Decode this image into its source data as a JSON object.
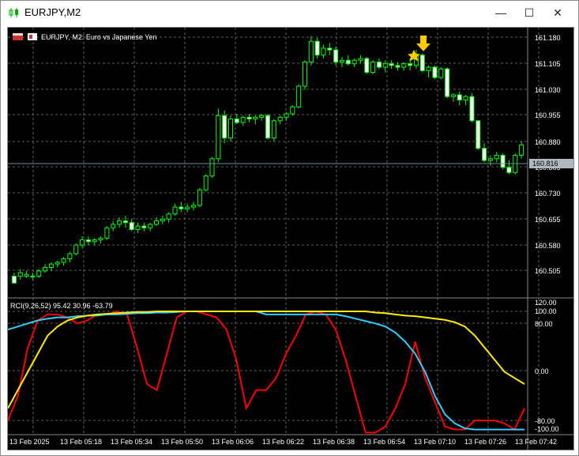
{
  "window": {
    "title": "EURJPY,M2",
    "controls": {
      "minimize": "—",
      "maximize": "☐",
      "close": "✕"
    }
  },
  "chart_header": {
    "label": "EURJPY, M2:  Euro vs Japanese Yen"
  },
  "price_axis": {
    "labels": [
      "161.180",
      "161.105",
      "161.030",
      "160.955",
      "160.880",
      "160.805",
      "160.730",
      "160.655",
      "160.580",
      "160.505"
    ],
    "current_price": "160.816"
  },
  "indicator_header": "RCI(9,26,52) 95.42 30.96 -63.79",
  "indicator_axis": {
    "labels": [
      "120.00",
      "100.00",
      "80.00",
      "0.00",
      "-80.00",
      "-100.00"
    ]
  },
  "time_axis": {
    "labels": [
      "13 Feb 2025",
      "13 Feb 05:18",
      "13 Feb 05:34",
      "13 Feb 05:50",
      "13 Feb 06:06",
      "13 Feb 06:22",
      "13 Feb 06:38",
      "13 Feb 06:54",
      "13 Feb 07:10",
      "13 Feb 07:26",
      "13 Feb 07:42"
    ]
  },
  "colors": {
    "background": "#000000",
    "candle": "#00ff00",
    "grid": "#606060",
    "rci_short": "#ff0000",
    "rci_mid": "#33ccff",
    "rci_long": "#ffee00",
    "marker": "#ffcc00"
  },
  "marker_icons": [
    "down-arrow-icon",
    "star-icon"
  ],
  "chart_data": [
    {
      "type": "candlestick",
      "title": "EURJPY, M2:  Euro vs Japanese Yen",
      "ylim": [
        160.47,
        161.21
      ],
      "y_ticks": [
        160.505,
        160.58,
        160.655,
        160.73,
        160.805,
        160.88,
        160.955,
        161.03,
        161.105,
        161.18
      ],
      "ohlc": [
        [
          160.488,
          160.498,
          160.468,
          160.468
        ],
        [
          160.488,
          160.508,
          160.478,
          160.498
        ],
        [
          160.488,
          160.503,
          160.483,
          160.493
        ],
        [
          160.488,
          160.498,
          160.478,
          160.488
        ],
        [
          160.488,
          160.508,
          160.483,
          160.503
        ],
        [
          160.503,
          160.523,
          160.498,
          160.513
        ],
        [
          160.513,
          160.528,
          160.503,
          160.523
        ],
        [
          160.523,
          160.533,
          160.513,
          160.528
        ],
        [
          160.528,
          160.543,
          160.518,
          160.538
        ],
        [
          160.538,
          160.558,
          160.528,
          160.553
        ],
        [
          160.553,
          160.583,
          160.548,
          160.578
        ],
        [
          160.578,
          160.603,
          160.568,
          160.593
        ],
        [
          160.593,
          160.603,
          160.578,
          160.588
        ],
        [
          160.588,
          160.598,
          160.578,
          160.593
        ],
        [
          160.593,
          160.603,
          160.583,
          160.598
        ],
        [
          160.598,
          160.633,
          160.593,
          160.628
        ],
        [
          160.628,
          160.648,
          160.618,
          160.638
        ],
        [
          160.638,
          160.658,
          160.628,
          160.648
        ],
        [
          160.648,
          160.663,
          160.628,
          160.643
        ],
        [
          160.643,
          160.653,
          160.618,
          160.623
        ],
        [
          160.623,
          160.643,
          160.613,
          160.633
        ],
        [
          160.633,
          160.643,
          160.618,
          160.628
        ],
        [
          160.628,
          160.643,
          160.618,
          160.638
        ],
        [
          160.638,
          160.658,
          160.633,
          160.648
        ],
        [
          160.648,
          160.663,
          160.638,
          160.653
        ],
        [
          160.653,
          160.673,
          160.643,
          160.668
        ],
        [
          160.668,
          160.698,
          160.663,
          160.688
        ],
        [
          160.688,
          160.703,
          160.673,
          160.683
        ],
        [
          160.683,
          160.698,
          160.673,
          160.688
        ],
        [
          160.688,
          160.703,
          160.678,
          160.693
        ],
        [
          160.693,
          160.743,
          160.688,
          160.738
        ],
        [
          160.738,
          160.783,
          160.733,
          160.778
        ],
        [
          160.778,
          160.833,
          160.773,
          160.828
        ],
        [
          160.828,
          160.973,
          160.818,
          160.953
        ],
        [
          160.953,
          160.968,
          160.873,
          160.888
        ],
        [
          160.888,
          160.953,
          160.878,
          160.943
        ],
        [
          160.943,
          160.958,
          160.928,
          160.933
        ],
        [
          160.933,
          160.953,
          160.923,
          160.948
        ],
        [
          160.948,
          160.958,
          160.933,
          160.943
        ],
        [
          160.943,
          160.953,
          160.928,
          160.948
        ],
        [
          160.948,
          160.958,
          160.938,
          160.953
        ],
        [
          160.953,
          160.958,
          160.883,
          160.888
        ],
        [
          160.888,
          160.943,
          160.878,
          160.938
        ],
        [
          160.938,
          160.953,
          160.928,
          160.948
        ],
        [
          160.948,
          160.963,
          160.938,
          160.958
        ],
        [
          160.958,
          160.983,
          160.953,
          160.978
        ],
        [
          160.978,
          161.043,
          160.973,
          161.038
        ],
        [
          161.038,
          161.113,
          161.028,
          161.108
        ],
        [
          161.108,
          161.183,
          161.098,
          161.168
        ],
        [
          161.168,
          161.178,
          161.118,
          161.128
        ],
        [
          161.128,
          161.158,
          161.118,
          161.148
        ],
        [
          161.148,
          161.163,
          161.128,
          161.143
        ],
        [
          161.143,
          161.153,
          161.098,
          161.108
        ],
        [
          161.108,
          161.123,
          161.093,
          161.113
        ],
        [
          161.113,
          161.128,
          161.098,
          161.103
        ],
        [
          161.103,
          161.118,
          161.093,
          161.113
        ],
        [
          161.113,
          161.128,
          161.103,
          161.118
        ],
        [
          161.118,
          161.123,
          161.073,
          161.078
        ],
        [
          161.078,
          161.113,
          161.073,
          161.108
        ],
        [
          161.108,
          161.118,
          161.088,
          161.093
        ],
        [
          161.093,
          161.113,
          161.078,
          161.103
        ],
        [
          161.103,
          161.113,
          161.088,
          161.098
        ],
        [
          161.098,
          161.108,
          161.083,
          161.093
        ],
        [
          161.093,
          161.108,
          161.083,
          161.103
        ],
        [
          161.103,
          161.118,
          161.083,
          161.098
        ],
        [
          161.098,
          161.143,
          161.088,
          161.128
        ],
        [
          161.128,
          161.133,
          161.078,
          161.083
        ],
        [
          161.083,
          161.098,
          161.063,
          161.093
        ],
        [
          161.093,
          161.098,
          161.058,
          161.063
        ],
        [
          161.063,
          161.093,
          161.058,
          161.088
        ],
        [
          161.088,
          161.093,
          161.003,
          161.008
        ],
        [
          161.008,
          161.018,
          160.993,
          161.013
        ],
        [
          161.013,
          161.023,
          160.983,
          160.998
        ],
        [
          160.998,
          161.013,
          160.983,
          161.008
        ],
        [
          161.008,
          161.018,
          160.933,
          160.938
        ],
        [
          160.938,
          160.923,
          160.853,
          160.858
        ],
        [
          160.858,
          160.873,
          160.818,
          160.823
        ],
        [
          160.823,
          160.838,
          160.808,
          160.828
        ],
        [
          160.828,
          160.848,
          160.818,
          160.838
        ],
        [
          160.838,
          160.843,
          160.798,
          160.803
        ],
        [
          160.803,
          160.823,
          160.783,
          160.788
        ],
        [
          160.788,
          160.843,
          160.783,
          160.838
        ],
        [
          160.838,
          160.878,
          160.828,
          160.868
        ]
      ]
    },
    {
      "type": "line",
      "title": "RCI(9,26,52) 95.42 30.96 -63.79",
      "ylim": [
        -100,
        120
      ],
      "series": [
        {
          "name": "RCI 9",
          "values": [
            -80,
            -40,
            40,
            85,
            95,
            95,
            90,
            80,
            85,
            95,
            95,
            100,
            95,
            40,
            -20,
            -30,
            30,
            90,
            100,
            100,
            95,
            90,
            70,
            20,
            -60,
            -30,
            -30,
            -10,
            30,
            60,
            95,
            100,
            95,
            70,
            20,
            -40,
            -100,
            -100,
            -90,
            -60,
            -20,
            50,
            -10,
            -50,
            -90,
            -95,
            -95,
            -80,
            -80,
            -80,
            -85,
            -95,
            -60
          ]
        },
        {
          "name": "RCI 26",
          "values": [
            70,
            75,
            80,
            85,
            88,
            90,
            90,
            92,
            93,
            93,
            95,
            95,
            96,
            97,
            97,
            98,
            98,
            99,
            100,
            100,
            100,
            100,
            100,
            100,
            100,
            100,
            95,
            95,
            95,
            95,
            95,
            95,
            95,
            95,
            92,
            88,
            84,
            80,
            75,
            65,
            50,
            30,
            0,
            -40,
            -70,
            -85,
            -93,
            -95,
            -95,
            -95,
            -95,
            -95,
            -95
          ]
        },
        {
          "name": "RCI 52",
          "values": [
            -60,
            -30,
            0,
            30,
            60,
            75,
            85,
            90,
            93,
            95,
            96,
            97,
            98,
            99,
            99,
            100,
            100,
            100,
            100,
            100,
            100,
            100,
            100,
            100,
            100,
            100,
            100,
            100,
            100,
            100,
            100,
            100,
            100,
            100,
            100,
            100,
            100,
            98,
            97,
            95,
            93,
            92,
            90,
            88,
            86,
            82,
            75,
            60,
            40,
            20,
            0,
            -10,
            -20
          ]
        }
      ]
    }
  ]
}
